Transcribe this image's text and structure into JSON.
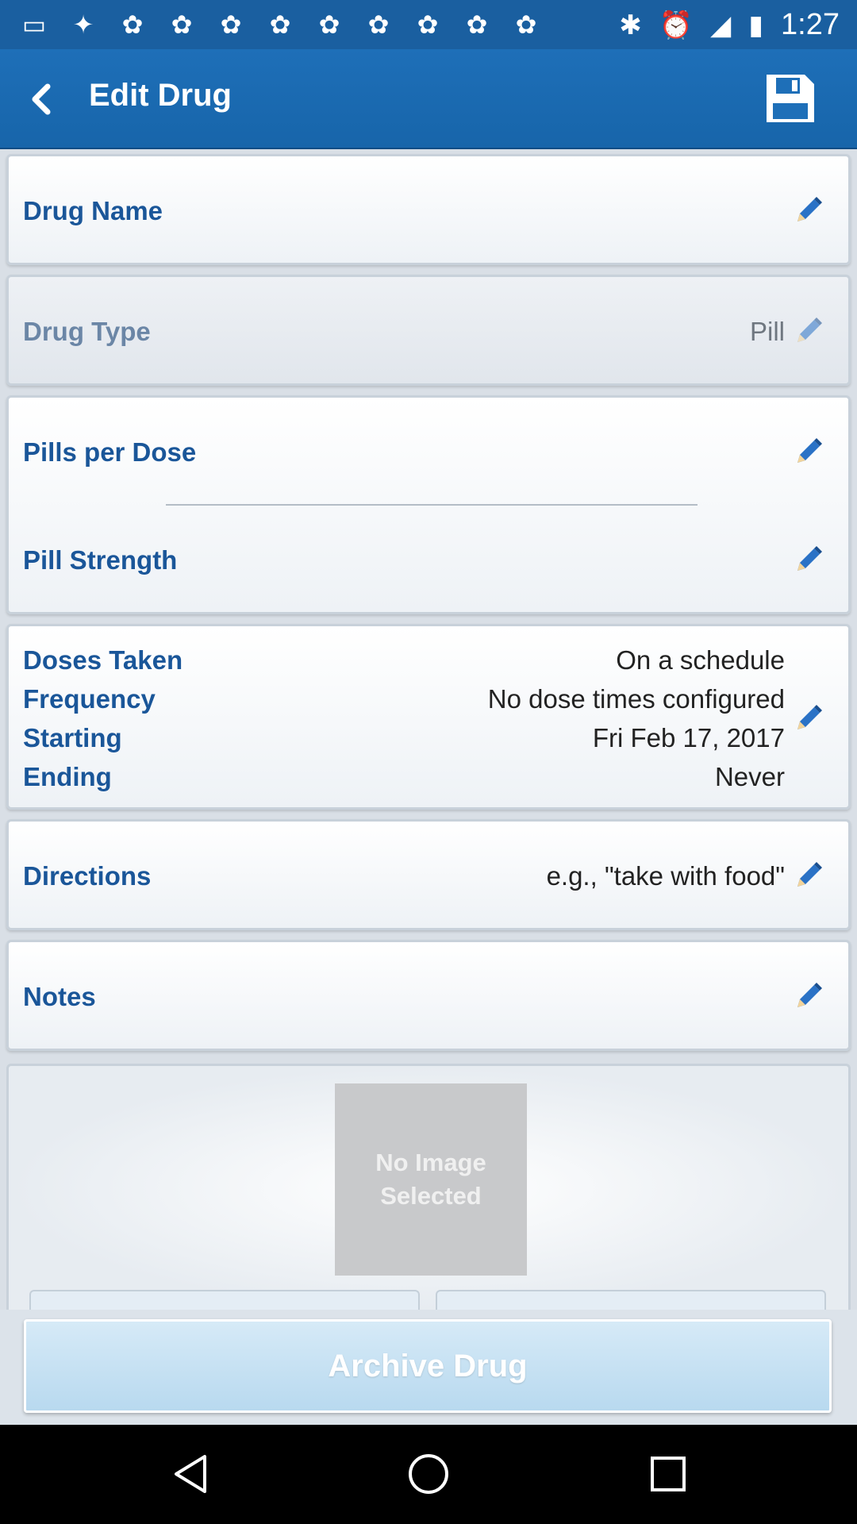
{
  "status_bar": {
    "notification_icons": [
      "app-icon",
      "pin-icon",
      "app-icon",
      "app-icon",
      "app-icon",
      "app-icon",
      "app-icon",
      "app-icon",
      "app-icon",
      "app-icon",
      "app-icon"
    ],
    "time": "1:27"
  },
  "header": {
    "title": "Edit Drug"
  },
  "fields": {
    "drug_name": {
      "label": "Drug Name",
      "value": ""
    },
    "drug_type": {
      "label": "Drug Type",
      "value": "Pill"
    },
    "pills_per_dose": {
      "label": "Pills per Dose",
      "value": ""
    },
    "pill_strength": {
      "label": "Pill Strength",
      "value": ""
    },
    "schedule": {
      "doses_taken_label": "Doses Taken",
      "doses_taken_value": "On a schedule",
      "frequency_label": "Frequency",
      "frequency_value": "No dose times configured",
      "starting_label": "Starting",
      "starting_value": "Fri Feb 17, 2017",
      "ending_label": "Ending",
      "ending_value": "Never"
    },
    "directions": {
      "label": "Directions",
      "placeholder": "e.g., \"take with food\""
    },
    "notes": {
      "label": "Notes",
      "value": ""
    }
  },
  "image": {
    "placeholder": "No Image Selected"
  },
  "footer": {
    "archive_label": "Archive Drug"
  },
  "colors": {
    "accent": "#1e6fb8",
    "label": "#1a5699"
  }
}
